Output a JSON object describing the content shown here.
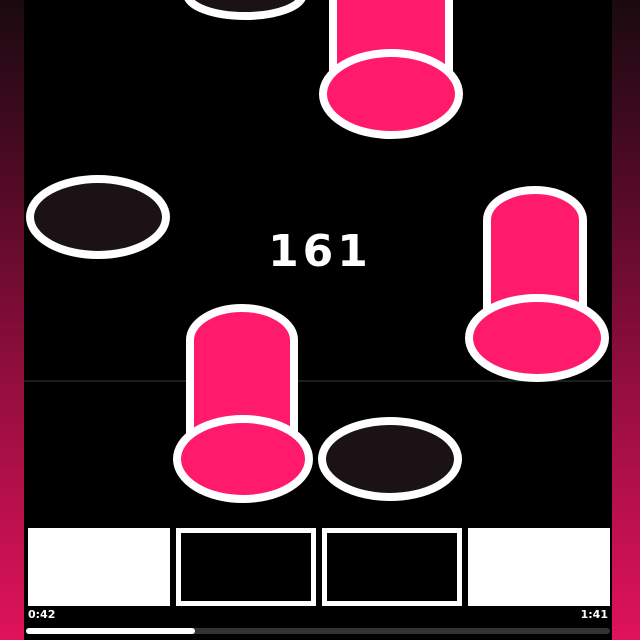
{
  "game": {
    "score": "161",
    "colors": {
      "accent": "#ff1a6b",
      "background": "#000000",
      "outline": "#ffffff",
      "hole": "#1a1214"
    }
  },
  "pads": [
    {
      "state": "lit"
    },
    {
      "state": "dark"
    },
    {
      "state": "dark"
    },
    {
      "state": "lit"
    }
  ],
  "player": {
    "elapsed": "0:42",
    "total": "1:41",
    "progress": 0.29
  }
}
